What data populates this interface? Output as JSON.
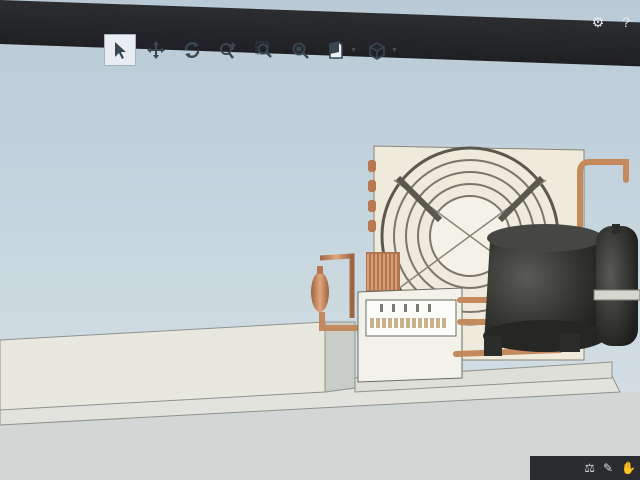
{
  "toolbar": {
    "tools": [
      {
        "id": "select",
        "icon": "arrow-pointer-icon",
        "active": true
      },
      {
        "id": "pan",
        "icon": "move-arrows-icon",
        "active": false
      },
      {
        "id": "rotate",
        "icon": "rotate-icon",
        "active": false
      },
      {
        "id": "zoom",
        "icon": "zoom-updown-icon",
        "active": false
      },
      {
        "id": "zoom-area",
        "icon": "zoom-area-icon",
        "active": false
      },
      {
        "id": "zoom-fit",
        "icon": "zoom-fit-icon",
        "active": false
      },
      {
        "id": "section",
        "icon": "section-view-icon",
        "active": false
      },
      {
        "id": "view-cube",
        "icon": "cube-view-icon",
        "active": false
      }
    ]
  },
  "topbar": {
    "settings_icon": "gear-icon",
    "help_label": "?"
  },
  "bottombar": {
    "items": [
      {
        "icon": "balance-icon",
        "label": ""
      },
      {
        "icon": "pencil-icon",
        "label": ""
      },
      {
        "icon": "annotation-icon",
        "label": ""
      }
    ]
  },
  "colors": {
    "background_top": "#bfcfd9",
    "background_bottom": "#d8e2e8",
    "frame": "#e6e3d6",
    "copper": "#c48a5e",
    "compressor": "#2f302d"
  }
}
